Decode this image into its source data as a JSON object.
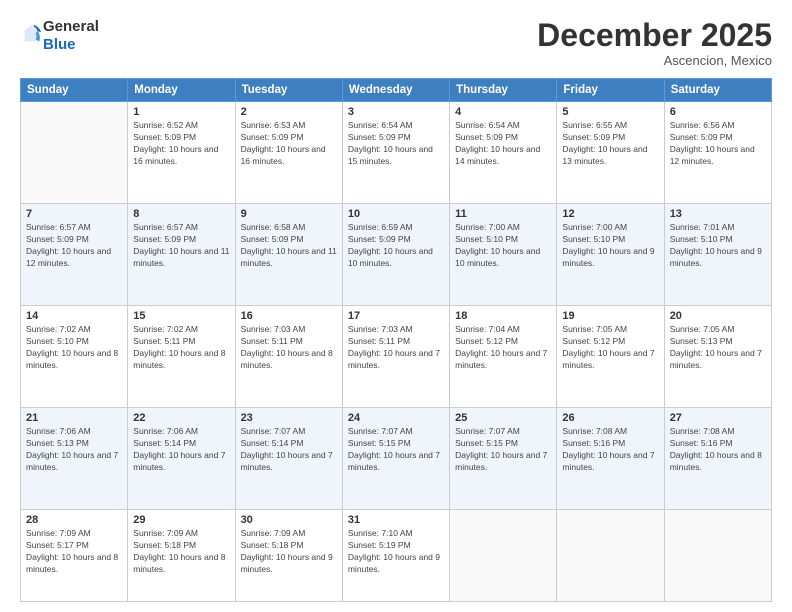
{
  "logo": {
    "general": "General",
    "blue": "Blue"
  },
  "header": {
    "month": "December 2025",
    "location": "Ascencion, Mexico"
  },
  "weekdays": [
    "Sunday",
    "Monday",
    "Tuesday",
    "Wednesday",
    "Thursday",
    "Friday",
    "Saturday"
  ],
  "weeks": [
    [
      {
        "day": "",
        "sunrise": "",
        "sunset": "",
        "daylight": ""
      },
      {
        "day": "1",
        "sunrise": "Sunrise: 6:52 AM",
        "sunset": "Sunset: 5:09 PM",
        "daylight": "Daylight: 10 hours and 16 minutes."
      },
      {
        "day": "2",
        "sunrise": "Sunrise: 6:53 AM",
        "sunset": "Sunset: 5:09 PM",
        "daylight": "Daylight: 10 hours and 16 minutes."
      },
      {
        "day": "3",
        "sunrise": "Sunrise: 6:54 AM",
        "sunset": "Sunset: 5:09 PM",
        "daylight": "Daylight: 10 hours and 15 minutes."
      },
      {
        "day": "4",
        "sunrise": "Sunrise: 6:54 AM",
        "sunset": "Sunset: 5:09 PM",
        "daylight": "Daylight: 10 hours and 14 minutes."
      },
      {
        "day": "5",
        "sunrise": "Sunrise: 6:55 AM",
        "sunset": "Sunset: 5:09 PM",
        "daylight": "Daylight: 10 hours and 13 minutes."
      },
      {
        "day": "6",
        "sunrise": "Sunrise: 6:56 AM",
        "sunset": "Sunset: 5:09 PM",
        "daylight": "Daylight: 10 hours and 12 minutes."
      }
    ],
    [
      {
        "day": "7",
        "sunrise": "Sunrise: 6:57 AM",
        "sunset": "Sunset: 5:09 PM",
        "daylight": "Daylight: 10 hours and 12 minutes."
      },
      {
        "day": "8",
        "sunrise": "Sunrise: 6:57 AM",
        "sunset": "Sunset: 5:09 PM",
        "daylight": "Daylight: 10 hours and 11 minutes."
      },
      {
        "day": "9",
        "sunrise": "Sunrise: 6:58 AM",
        "sunset": "Sunset: 5:09 PM",
        "daylight": "Daylight: 10 hours and 11 minutes."
      },
      {
        "day": "10",
        "sunrise": "Sunrise: 6:59 AM",
        "sunset": "Sunset: 5:09 PM",
        "daylight": "Daylight: 10 hours and 10 minutes."
      },
      {
        "day": "11",
        "sunrise": "Sunrise: 7:00 AM",
        "sunset": "Sunset: 5:10 PM",
        "daylight": "Daylight: 10 hours and 10 minutes."
      },
      {
        "day": "12",
        "sunrise": "Sunrise: 7:00 AM",
        "sunset": "Sunset: 5:10 PM",
        "daylight": "Daylight: 10 hours and 9 minutes."
      },
      {
        "day": "13",
        "sunrise": "Sunrise: 7:01 AM",
        "sunset": "Sunset: 5:10 PM",
        "daylight": "Daylight: 10 hours and 9 minutes."
      }
    ],
    [
      {
        "day": "14",
        "sunrise": "Sunrise: 7:02 AM",
        "sunset": "Sunset: 5:10 PM",
        "daylight": "Daylight: 10 hours and 8 minutes."
      },
      {
        "day": "15",
        "sunrise": "Sunrise: 7:02 AM",
        "sunset": "Sunset: 5:11 PM",
        "daylight": "Daylight: 10 hours and 8 minutes."
      },
      {
        "day": "16",
        "sunrise": "Sunrise: 7:03 AM",
        "sunset": "Sunset: 5:11 PM",
        "daylight": "Daylight: 10 hours and 8 minutes."
      },
      {
        "day": "17",
        "sunrise": "Sunrise: 7:03 AM",
        "sunset": "Sunset: 5:11 PM",
        "daylight": "Daylight: 10 hours and 7 minutes."
      },
      {
        "day": "18",
        "sunrise": "Sunrise: 7:04 AM",
        "sunset": "Sunset: 5:12 PM",
        "daylight": "Daylight: 10 hours and 7 minutes."
      },
      {
        "day": "19",
        "sunrise": "Sunrise: 7:05 AM",
        "sunset": "Sunset: 5:12 PM",
        "daylight": "Daylight: 10 hours and 7 minutes."
      },
      {
        "day": "20",
        "sunrise": "Sunrise: 7:05 AM",
        "sunset": "Sunset: 5:13 PM",
        "daylight": "Daylight: 10 hours and 7 minutes."
      }
    ],
    [
      {
        "day": "21",
        "sunrise": "Sunrise: 7:06 AM",
        "sunset": "Sunset: 5:13 PM",
        "daylight": "Daylight: 10 hours and 7 minutes."
      },
      {
        "day": "22",
        "sunrise": "Sunrise: 7:06 AM",
        "sunset": "Sunset: 5:14 PM",
        "daylight": "Daylight: 10 hours and 7 minutes."
      },
      {
        "day": "23",
        "sunrise": "Sunrise: 7:07 AM",
        "sunset": "Sunset: 5:14 PM",
        "daylight": "Daylight: 10 hours and 7 minutes."
      },
      {
        "day": "24",
        "sunrise": "Sunrise: 7:07 AM",
        "sunset": "Sunset: 5:15 PM",
        "daylight": "Daylight: 10 hours and 7 minutes."
      },
      {
        "day": "25",
        "sunrise": "Sunrise: 7:07 AM",
        "sunset": "Sunset: 5:15 PM",
        "daylight": "Daylight: 10 hours and 7 minutes."
      },
      {
        "day": "26",
        "sunrise": "Sunrise: 7:08 AM",
        "sunset": "Sunset: 5:16 PM",
        "daylight": "Daylight: 10 hours and 7 minutes."
      },
      {
        "day": "27",
        "sunrise": "Sunrise: 7:08 AM",
        "sunset": "Sunset: 5:16 PM",
        "daylight": "Daylight: 10 hours and 8 minutes."
      }
    ],
    [
      {
        "day": "28",
        "sunrise": "Sunrise: 7:09 AM",
        "sunset": "Sunset: 5:17 PM",
        "daylight": "Daylight: 10 hours and 8 minutes."
      },
      {
        "day": "29",
        "sunrise": "Sunrise: 7:09 AM",
        "sunset": "Sunset: 5:18 PM",
        "daylight": "Daylight: 10 hours and 8 minutes."
      },
      {
        "day": "30",
        "sunrise": "Sunrise: 7:09 AM",
        "sunset": "Sunset: 5:18 PM",
        "daylight": "Daylight: 10 hours and 9 minutes."
      },
      {
        "day": "31",
        "sunrise": "Sunrise: 7:10 AM",
        "sunset": "Sunset: 5:19 PM",
        "daylight": "Daylight: 10 hours and 9 minutes."
      },
      {
        "day": "",
        "sunrise": "",
        "sunset": "",
        "daylight": ""
      },
      {
        "day": "",
        "sunrise": "",
        "sunset": "",
        "daylight": ""
      },
      {
        "day": "",
        "sunrise": "",
        "sunset": "",
        "daylight": ""
      }
    ]
  ]
}
